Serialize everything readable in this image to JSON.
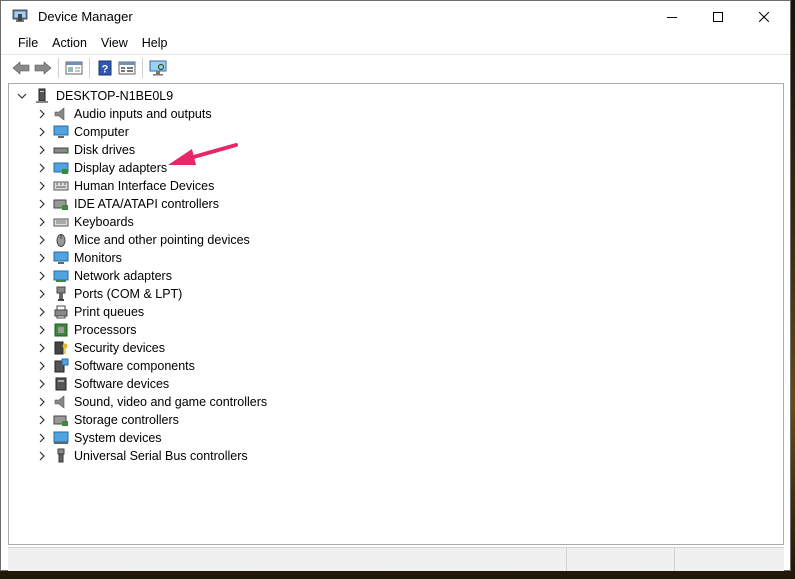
{
  "window": {
    "title": "Device Manager",
    "controls": [
      "minimize",
      "maximize",
      "close"
    ]
  },
  "menu": [
    "File",
    "Action",
    "View",
    "Help"
  ],
  "toolbar": [
    {
      "name": "back-button",
      "icon": "arrow-left-icon"
    },
    {
      "name": "forward-button",
      "icon": "arrow-right-icon"
    },
    {
      "name": "show-hide-console-tree-button",
      "icon": "console-tree-icon"
    },
    {
      "name": "help-button",
      "icon": "help-icon"
    },
    {
      "name": "properties-button",
      "icon": "properties-icon"
    },
    {
      "name": "scan-hardware-button",
      "icon": "monitor-scan-icon"
    }
  ],
  "tree": {
    "root": "DESKTOP-N1BE0L9",
    "nodes": [
      {
        "label": "Audio inputs and outputs",
        "icon": "speaker-icon"
      },
      {
        "label": "Computer",
        "icon": "computer-icon"
      },
      {
        "label": "Disk drives",
        "icon": "disk-drive-icon"
      },
      {
        "label": "Display adapters",
        "icon": "display-adapter-icon"
      },
      {
        "label": "Human Interface Devices",
        "icon": "hid-icon"
      },
      {
        "label": "IDE ATA/ATAPI controllers",
        "icon": "ide-controller-icon"
      },
      {
        "label": "Keyboards",
        "icon": "keyboard-icon"
      },
      {
        "label": "Mice and other pointing devices",
        "icon": "mouse-icon"
      },
      {
        "label": "Monitors",
        "icon": "monitor-icon"
      },
      {
        "label": "Network adapters",
        "icon": "network-adapter-icon"
      },
      {
        "label": "Ports (COM & LPT)",
        "icon": "port-icon"
      },
      {
        "label": "Print queues",
        "icon": "printer-icon"
      },
      {
        "label": "Processors",
        "icon": "processor-icon"
      },
      {
        "label": "Security devices",
        "icon": "security-key-icon"
      },
      {
        "label": "Software components",
        "icon": "software-component-icon"
      },
      {
        "label": "Software devices",
        "icon": "software-device-icon"
      },
      {
        "label": "Sound, video and game controllers",
        "icon": "sound-icon"
      },
      {
        "label": "Storage controllers",
        "icon": "storage-controller-icon"
      },
      {
        "label": "System devices",
        "icon": "system-device-icon"
      },
      {
        "label": "Universal Serial Bus controllers",
        "icon": "usb-icon"
      }
    ]
  },
  "annotation": {
    "color": "#e8266a",
    "points_to": "Display adapters"
  }
}
